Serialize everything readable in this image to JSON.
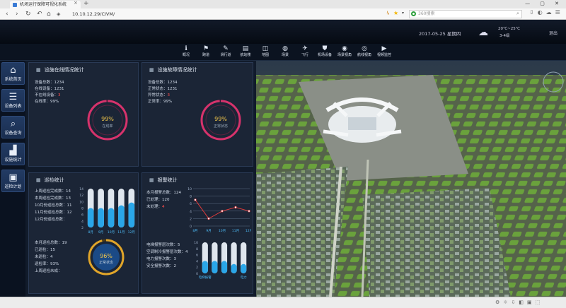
{
  "browser": {
    "tab_title": "机场运行保障可视化系统",
    "url": "10.10.12.29/CIVM/",
    "search_placeholder": "360搜索",
    "new_tab_symbol": "+",
    "close_symbol": "×"
  },
  "header": {
    "date": "2017-05-25  星期四",
    "temperature": "20℃~25℃",
    "wind": "3-4级",
    "logout": "退出"
  },
  "toolbar": [
    {
      "icon": "info-icon",
      "glyph": "ℹ",
      "label": "概况"
    },
    {
      "icon": "flag-icon",
      "glyph": "⚑",
      "label": "跑道"
    },
    {
      "icon": "pen-icon",
      "glyph": "✎",
      "label": "滑行道"
    },
    {
      "icon": "building-icon",
      "glyph": "▤",
      "label": "航站楼"
    },
    {
      "icon": "map-icon",
      "glyph": "◫",
      "label": "地图"
    },
    {
      "icon": "globe-icon",
      "glyph": "◍",
      "label": "场景"
    },
    {
      "icon": "plane-icon",
      "glyph": "✈",
      "label": "飞行"
    },
    {
      "icon": "shield-icon",
      "glyph": "⛊",
      "label": "机场设备"
    },
    {
      "icon": "eye-icon",
      "glyph": "◉",
      "label": "场景视角"
    },
    {
      "icon": "eye2-icon",
      "glyph": "◎",
      "label": "航线视角"
    },
    {
      "icon": "play-icon",
      "glyph": "▶",
      "label": "视频监控"
    }
  ],
  "sidebar": [
    {
      "icon": "home-icon",
      "glyph": "⌂",
      "label": "系统首页"
    },
    {
      "icon": "list-icon",
      "glyph": "☰",
      "label": "设备列表"
    },
    {
      "icon": "search-icon",
      "glyph": "⌕",
      "label": "设备查询"
    },
    {
      "icon": "chart-icon",
      "glyph": "▟",
      "label": "设施统计"
    },
    {
      "icon": "clipboard-icon",
      "glyph": "▣",
      "label": "巡检计划"
    }
  ],
  "panels": {
    "online": {
      "title": "设施在线情况统计",
      "lines": [
        "设备总数：1234",
        "在线设备：1231",
        "不在线设备：",
        "在线率：99%"
      ],
      "offline_value": "3",
      "gauge_value": "99%",
      "gauge_label": "在线率",
      "gauge_fraction": 0.99
    },
    "fault": {
      "title": "设施故障情况统计",
      "lines": [
        "设备总数：1234",
        "正常状态：1231",
        "异常状态：",
        "正常率：99%"
      ],
      "abnormal_value": "3",
      "gauge_value": "99%",
      "gauge_label": "正常状态",
      "gauge_fraction": 0.99
    },
    "inspection": {
      "title": "巡检统计",
      "lines": [
        "上周巡检完成数：14",
        "本周巡检完成数：13",
        "10月份巡检总数：11",
        "11月份巡检总数：12",
        "12月份巡检总数："
      ],
      "bottom_lines": [
        "本月巡检总数：19",
        "已巡检：15",
        "未巡检：4",
        "巡检率：93%",
        "上周巡检未成："
      ],
      "gauge_value": "96%",
      "gauge_label": "正常状态",
      "gauge_fraction": 0.96
    },
    "alarm": {
      "title": "报警统计",
      "lines": [
        "本月报警总数：124",
        "已处理：120",
        "未处理："
      ],
      "unhandled_value": "4",
      "bottom_lines": [
        "电梯报警层次数：5",
        "空调制冷报警层次数：4",
        "电力报警次数：3",
        "安全报警次数：2"
      ]
    }
  },
  "chart_data": [
    {
      "type": "bar",
      "categories": [
        "8月",
        "9月",
        "10月",
        "11月",
        "12月"
      ],
      "ylim": [
        0,
        14
      ],
      "y_ticks": [
        "14",
        "12",
        "10",
        "8",
        "6",
        "4",
        "2"
      ],
      "values": [
        7,
        7,
        7,
        8,
        9
      ],
      "max_values": [
        14,
        14,
        14,
        14,
        14
      ]
    },
    {
      "type": "line",
      "categories": [
        "8月",
        "9月",
        "10月",
        "11月",
        "12月"
      ],
      "ylim": [
        0,
        10
      ],
      "y_ticks": [
        "10",
        "8",
        "6",
        "4",
        "2",
        "0"
      ],
      "values": [
        7,
        2,
        4,
        5,
        4
      ]
    },
    {
      "type": "bar",
      "categories": [
        "电梯报警",
        "",
        "",
        "",
        "电力"
      ],
      "ylim": [
        0,
        10
      ],
      "y_ticks": [
        "10",
        "8",
        "6",
        "4",
        "2",
        "0"
      ],
      "values": [
        4,
        4,
        4,
        3,
        3
      ],
      "max_values": [
        10,
        10,
        10,
        10,
        10
      ]
    }
  ],
  "colors": {
    "accent": "#2aa6e8",
    "gauge_ring": "#d6336c",
    "gauge_ring_2": "#e0a52a",
    "alarm_line": "#e03b3b",
    "alert": "#ff4d4d"
  }
}
